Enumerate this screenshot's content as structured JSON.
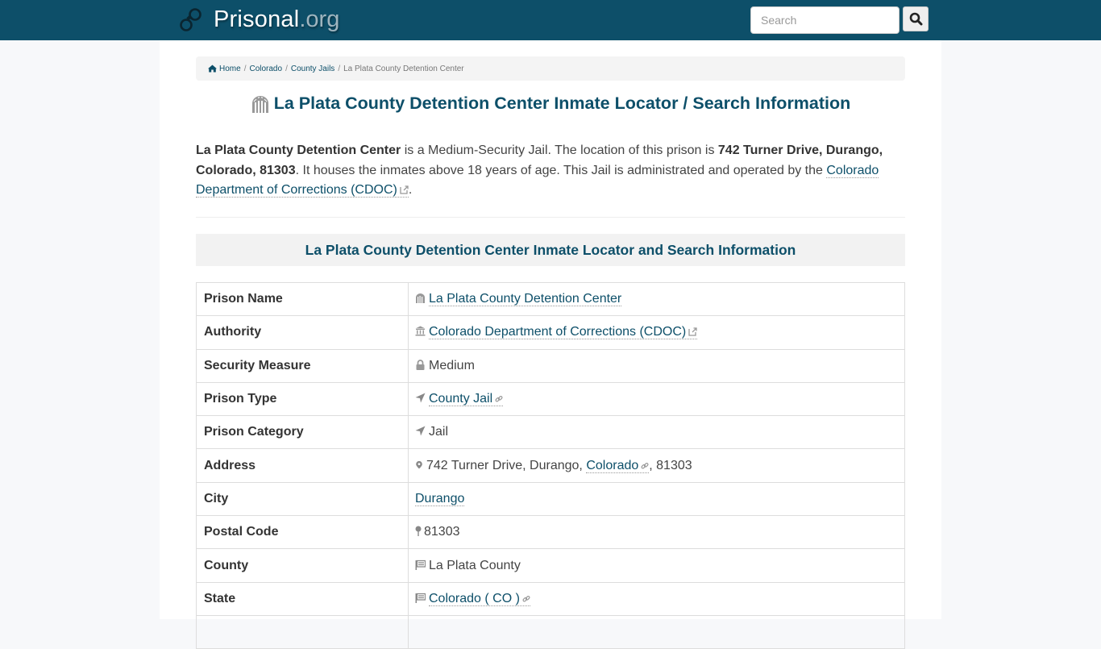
{
  "navbar": {
    "brand_name": "Prisonal",
    "brand_tld": ".org",
    "search_placeholder": "Search",
    "search_value": ""
  },
  "breadcrumb": {
    "items": [
      {
        "label": "Home"
      },
      {
        "label": "Colorado"
      },
      {
        "label": "County Jails"
      },
      {
        "label": "La Plata County Detention Center"
      }
    ],
    "separator": "/"
  },
  "page": {
    "title": "La Plata County Detention Center Inmate Locator / Search Information",
    "intro": {
      "name": "La Plata County Detention Center",
      "text1": " is a Medium-Security Jail. The location of this prison is ",
      "address": "742 Turner Drive, Durango, Colorado, 81303",
      "text2": ". It houses the inmates above 18 years of age. This Jail is administrated and operated by the ",
      "authority_link": "Colorado Department of Corrections (CDOC)",
      "text3": "."
    },
    "section_heading": "La Plata County Detention Center Inmate Locator and Search Information"
  },
  "table": {
    "rows": [
      {
        "label": "Prison Name",
        "value": "La Plata County Detention Center",
        "icon": "prison-icon"
      },
      {
        "label": "Authority",
        "value": "Colorado Department of Corrections (CDOC)",
        "icon": "bank-icon"
      },
      {
        "label": "Security Measure",
        "value": "Medium",
        "icon": "lock-icon"
      },
      {
        "label": "Prison Type",
        "value": "County Jail",
        "icon": "location-arrow-icon"
      },
      {
        "label": "Prison Category",
        "value": "Jail",
        "icon": "location-arrow-icon"
      },
      {
        "label": "Address",
        "value_prefix": "742 Turner Drive, Durango, ",
        "value_link": "Colorado",
        "value_suffix": ", 81303",
        "icon": "map-marker-icon"
      },
      {
        "label": "City",
        "value": "Durango"
      },
      {
        "label": "Postal Code",
        "value": "81303",
        "icon": "map-pin-icon"
      },
      {
        "label": "County",
        "value": "La Plata County",
        "icon": "flag-icon"
      },
      {
        "label": "State",
        "value": "Colorado ( CO )",
        "icon": "flag-icon"
      }
    ]
  },
  "colors": {
    "brand": "#0d4f69",
    "link": "#0d4f69",
    "icon_gray": "#888888"
  }
}
